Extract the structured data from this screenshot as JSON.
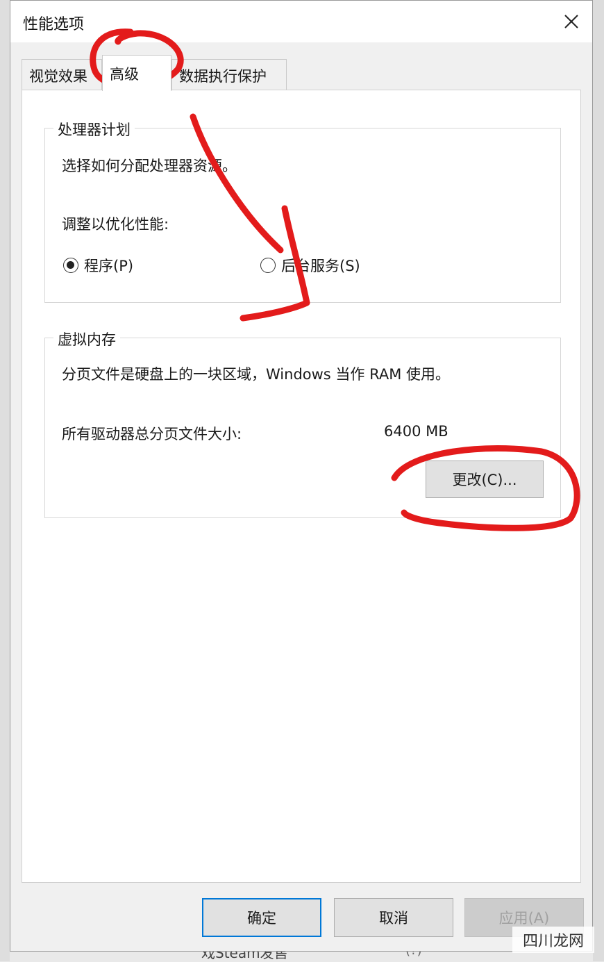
{
  "dialog": {
    "title": "性能选项",
    "tabs": [
      {
        "label": "视觉效果",
        "active": false
      },
      {
        "label": "高级",
        "active": true
      },
      {
        "label": "数据执行保护",
        "active": false
      }
    ]
  },
  "processor": {
    "group_title": "处理器计划",
    "description": "选择如何分配处理器资源。",
    "adjust_label": "调整以优化性能:",
    "options": [
      {
        "label": "程序(P)",
        "checked": true
      },
      {
        "label": "后台服务(S)",
        "checked": false
      }
    ]
  },
  "virtual_memory": {
    "group_title": "虚拟内存",
    "description": "分页文件是硬盘上的一块区域，Windows 当作 RAM 使用。",
    "total_label": "所有驱动器总分页文件大小:",
    "total_value": "6400 MB",
    "change_button": "更改(C)..."
  },
  "footer": {
    "ok": "确定",
    "cancel": "取消",
    "apply": "应用(A)"
  },
  "background": {
    "bottom_text": "戏Steam发售",
    "help_glyph": "(?)"
  },
  "watermark": "四川龙网",
  "annotation_color": "#e31b1b"
}
